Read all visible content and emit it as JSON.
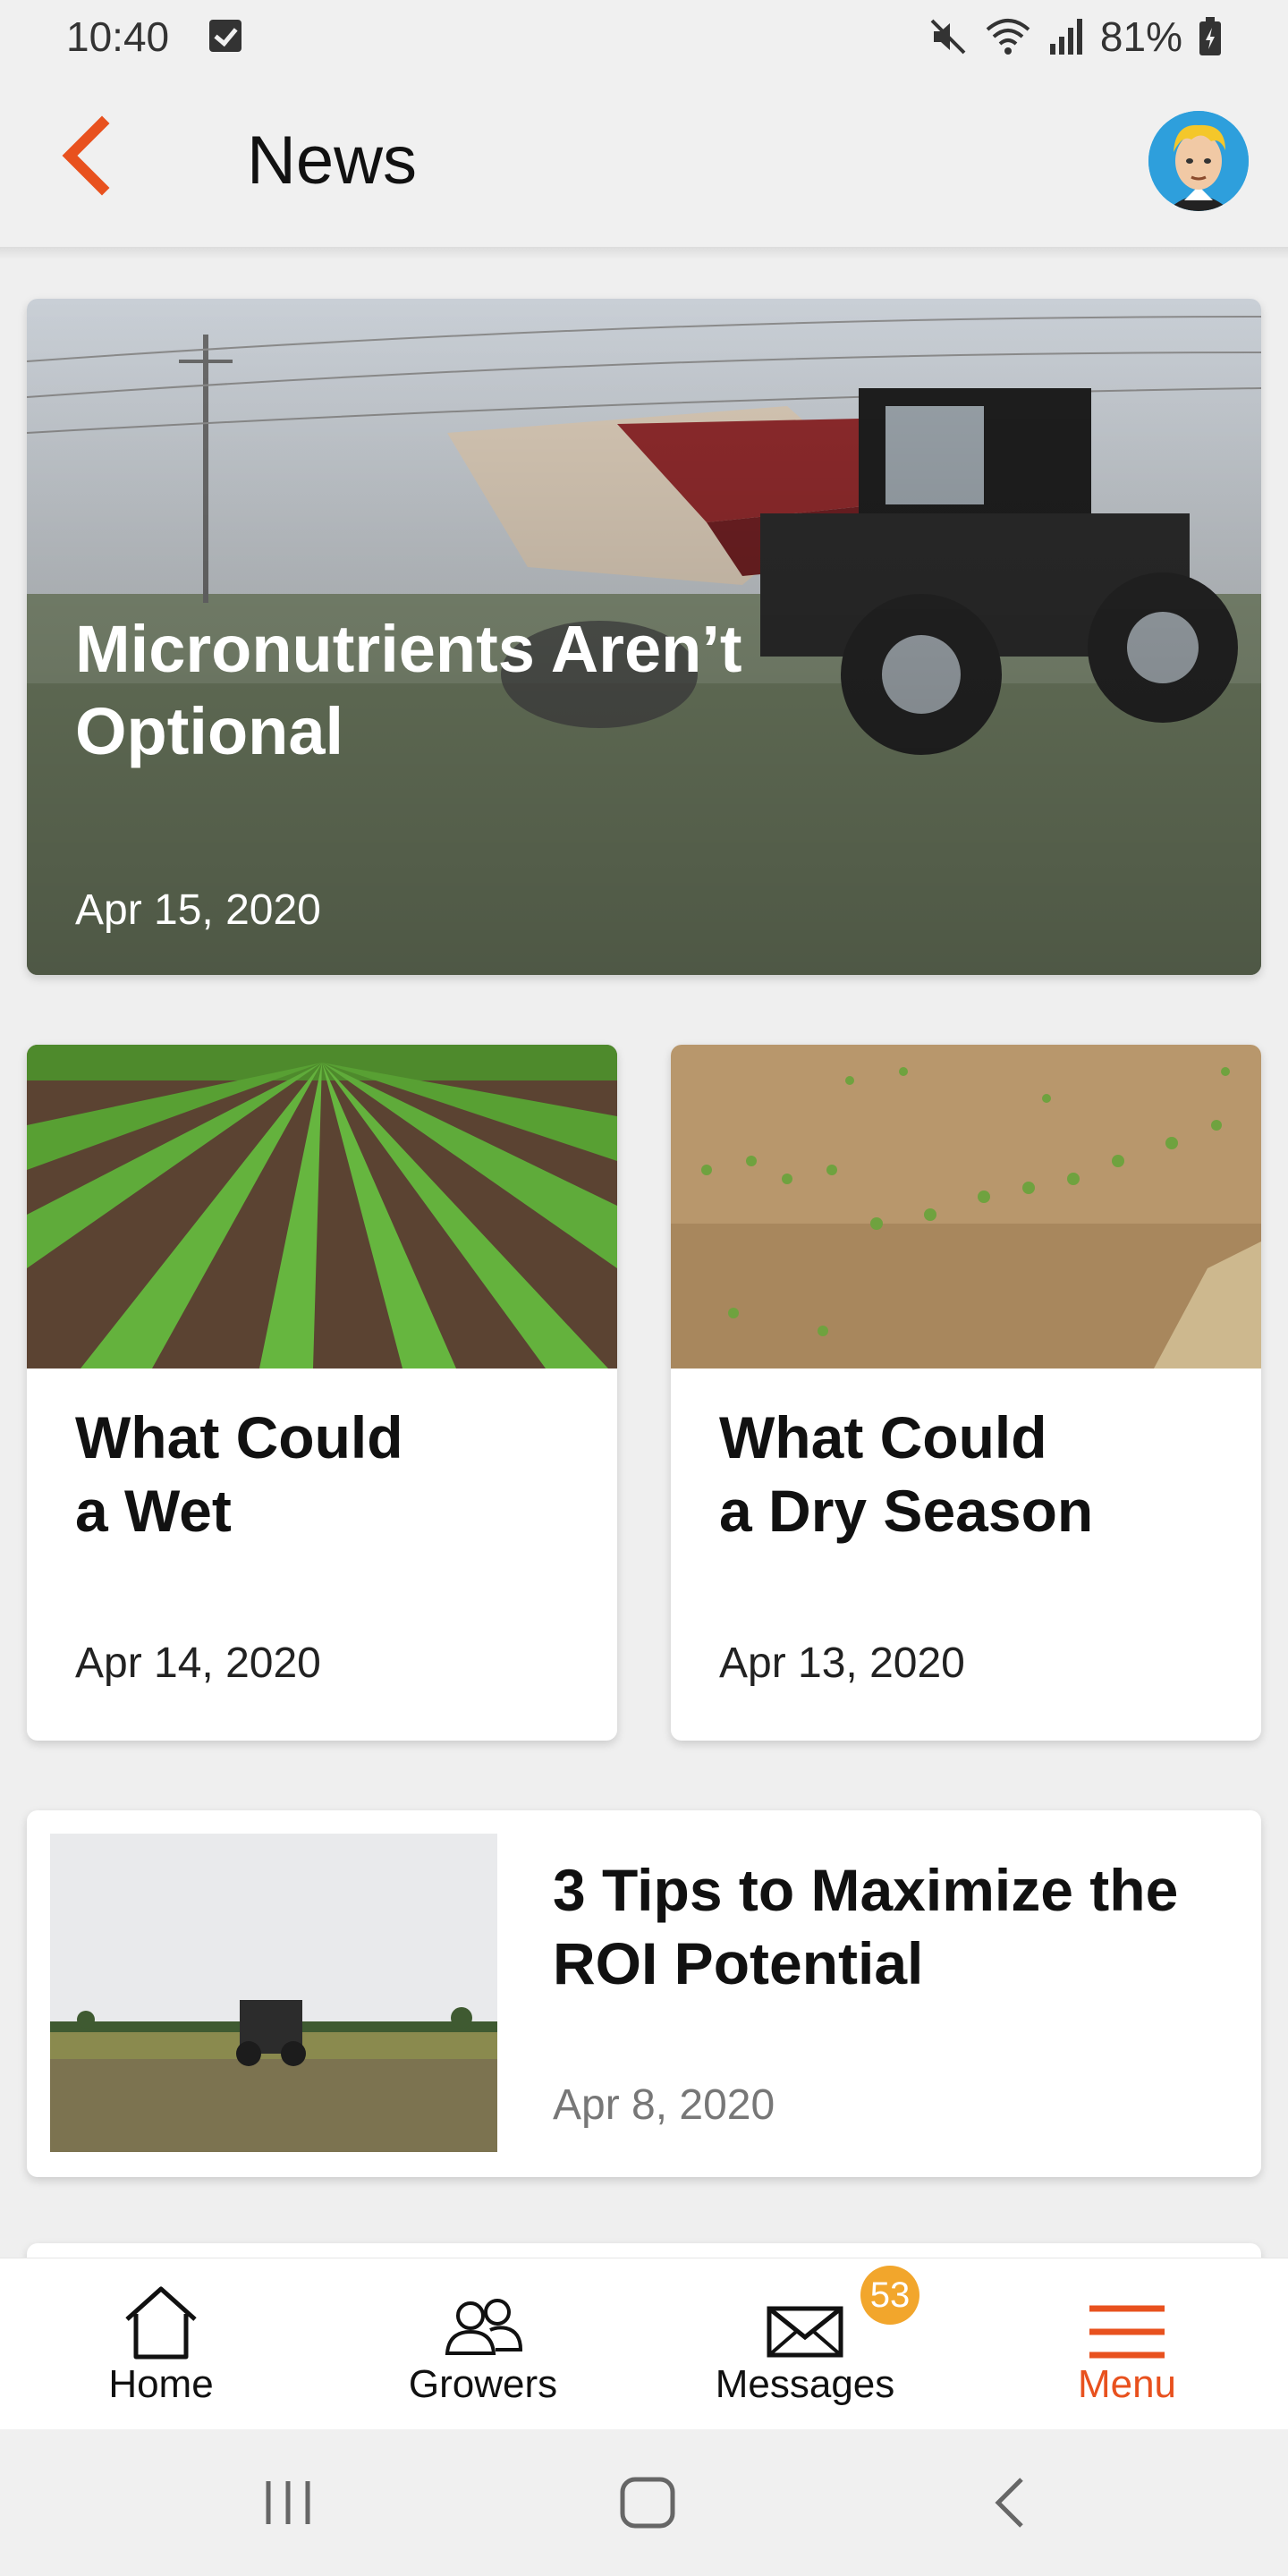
{
  "status_bar": {
    "time": "10:40",
    "battery": "81%"
  },
  "header": {
    "title": "News"
  },
  "colors": {
    "accent": "#e8511e",
    "badge": "#f2a62c"
  },
  "articles": {
    "featured": {
      "title": "Micronutrients Aren’t Optional",
      "date": "Apr 15, 2020"
    },
    "tiles": [
      {
        "title_line1": "What Could",
        "title_line2": "a Wet",
        "date": "Apr 14, 2020"
      },
      {
        "title_line1": "What Could",
        "title_line2": "a Dry Season",
        "date": "Apr 13, 2020"
      }
    ],
    "row": {
      "title": "3 Tips to Maximize the ROI Potential",
      "date": "Apr 8, 2020"
    }
  },
  "bottom_nav": {
    "items": [
      {
        "label": "Home",
        "icon": "home-icon"
      },
      {
        "label": "Growers",
        "icon": "growers-icon"
      },
      {
        "label": "Messages",
        "icon": "envelope-icon",
        "badge": "53"
      },
      {
        "label": "Menu",
        "icon": "hamburger-icon",
        "active": true
      }
    ]
  },
  "system_nav": {
    "icons": [
      "recents-icon",
      "home-button-icon",
      "back-nav-icon"
    ]
  }
}
